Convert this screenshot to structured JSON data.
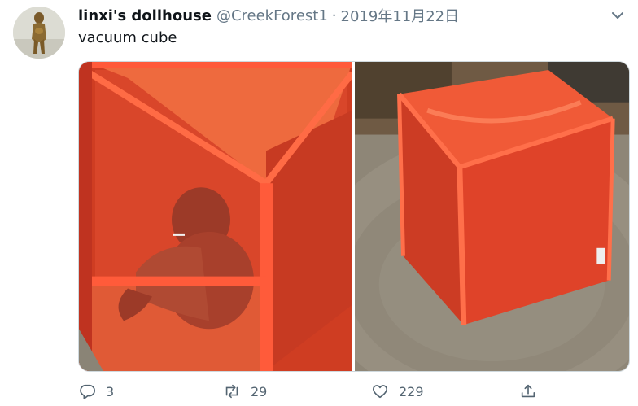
{
  "tweet": {
    "display_name": "linxi's dollhouse",
    "handle": "@CreekForest1",
    "separator": "·",
    "date": "2019年11月22日",
    "text": "vacuum cube"
  },
  "media": {
    "count": 2,
    "photos": [
      {
        "subject": "figure in red vacuum cube frame"
      },
      {
        "subject": "red vacuum cube on grey rug"
      }
    ]
  },
  "actions": {
    "reply_count": "3",
    "retweet_count": "29",
    "like_count": "229"
  },
  "icons": {
    "more": "chevron-down-icon",
    "reply": "reply-icon",
    "retweet": "retweet-icon",
    "like": "heart-icon",
    "share": "share-icon"
  },
  "colors": {
    "name": "#0f1419",
    "muted": "#657786",
    "cube_red": "#e23a22"
  }
}
